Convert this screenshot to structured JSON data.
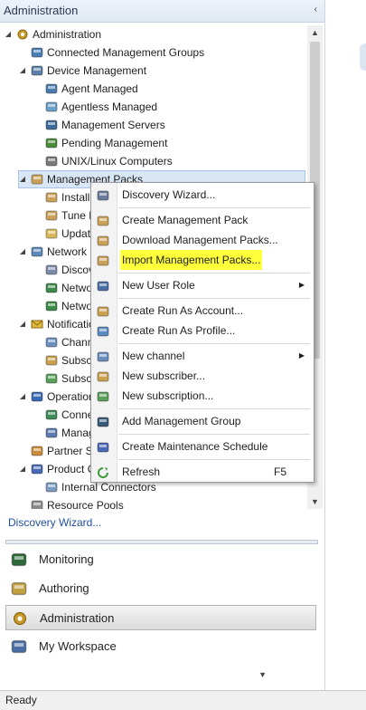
{
  "pane": {
    "title": "Administration",
    "collapse_glyph": "‹"
  },
  "tree": [
    {
      "label": "Administration",
      "icon": "gear-icon",
      "indent": 0,
      "expander": "◢"
    },
    {
      "label": "Connected Management Groups",
      "icon": "network-icon",
      "indent": 1,
      "expander": ""
    },
    {
      "label": "Device Management",
      "icon": "computer-icon",
      "indent": 1,
      "expander": "◢"
    },
    {
      "label": "Agent Managed",
      "icon": "agent-icon",
      "indent": 2,
      "expander": ""
    },
    {
      "label": "Agentless Managed",
      "icon": "agentless-icon",
      "indent": 2,
      "expander": ""
    },
    {
      "label": "Management Servers",
      "icon": "server-icon",
      "indent": 2,
      "expander": ""
    },
    {
      "label": "Pending Management",
      "icon": "pending-icon",
      "indent": 2,
      "expander": ""
    },
    {
      "label": "UNIX/Linux Computers",
      "icon": "unix-icon",
      "indent": 2,
      "expander": ""
    },
    {
      "label": "Management Packs",
      "icon": "package-icon",
      "indent": 1,
      "expander": "◢",
      "selected": true
    },
    {
      "label": "Installed",
      "icon": "package-icon",
      "indent": 2,
      "expander": ""
    },
    {
      "label": "Tune Mar",
      "icon": "package-icon",
      "indent": 2,
      "expander": ""
    },
    {
      "label": "Updates",
      "icon": "updates-icon",
      "indent": 2,
      "expander": ""
    },
    {
      "label": "Network M",
      "icon": "network-monitor-icon",
      "indent": 1,
      "expander": "◢"
    },
    {
      "label": "Discover",
      "icon": "discovery-icon",
      "indent": 2,
      "expander": ""
    },
    {
      "label": "Network",
      "icon": "network-device-icon",
      "indent": 2,
      "expander": ""
    },
    {
      "label": "Network",
      "icon": "network-device-icon",
      "indent": 2,
      "expander": ""
    },
    {
      "label": "Notificatio",
      "icon": "envelope-icon",
      "indent": 1,
      "expander": "◢"
    },
    {
      "label": "Channels",
      "icon": "channel-icon",
      "indent": 2,
      "expander": ""
    },
    {
      "label": "Subscrib",
      "icon": "subscriber-icon",
      "indent": 2,
      "expander": ""
    },
    {
      "label": "Subscrip",
      "icon": "subscription-icon",
      "indent": 2,
      "expander": ""
    },
    {
      "label": "Operation",
      "icon": "operations-icon",
      "indent": 1,
      "expander": "◢"
    },
    {
      "label": "Connecti",
      "icon": "globe-icon",
      "indent": 2,
      "expander": ""
    },
    {
      "label": "Managed",
      "icon": "managed-icon",
      "indent": 2,
      "expander": ""
    },
    {
      "label": "Partner So",
      "icon": "partner-icon",
      "indent": 1,
      "expander": ""
    },
    {
      "label": "Product Co",
      "icon": "product-icon",
      "indent": 1,
      "expander": "◢"
    },
    {
      "label": "Internal Connectors",
      "icon": "connector-icon",
      "indent": 2,
      "expander": ""
    },
    {
      "label": "Resource Pools",
      "icon": "pool-icon",
      "indent": 1,
      "expander": ""
    }
  ],
  "task_link": "Discovery Wizard...",
  "wunderbar": [
    {
      "label": "Monitoring",
      "icon": "monitoring-icon",
      "active": false
    },
    {
      "label": "Authoring",
      "icon": "authoring-icon",
      "active": false
    },
    {
      "label": "Administration",
      "icon": "gear-icon",
      "active": true
    },
    {
      "label": "My Workspace",
      "icon": "workspace-icon",
      "active": false
    }
  ],
  "more_glyph": "▼",
  "status": "Ready",
  "context_menu": [
    {
      "label": "Discovery Wizard...",
      "icon": "wizard-icon"
    },
    {
      "sep": true
    },
    {
      "label": "Create Management Pack",
      "icon": "package-icon"
    },
    {
      "label": "Download Management Packs...",
      "icon": "download-icon"
    },
    {
      "label": "Import Management Packs...",
      "icon": "import-icon",
      "highlight": true
    },
    {
      "sep": true
    },
    {
      "label": "New User Role",
      "icon": "user-role-icon",
      "submenu": true
    },
    {
      "sep": true
    },
    {
      "label": "Create Run As Account...",
      "icon": "runas-account-icon"
    },
    {
      "label": "Create Run As Profile...",
      "icon": "runas-profile-icon"
    },
    {
      "sep": true
    },
    {
      "label": "New channel",
      "icon": "channel-icon",
      "submenu": true
    },
    {
      "label": "New subscriber...",
      "icon": "subscriber-icon"
    },
    {
      "label": "New subscription...",
      "icon": "subscription-icon"
    },
    {
      "sep": true
    },
    {
      "label": "Add Management Group",
      "icon": "add-group-icon"
    },
    {
      "sep": true
    },
    {
      "label": "Create Maintenance Schedule",
      "icon": "maintenance-icon"
    },
    {
      "sep": true
    },
    {
      "label": "Refresh",
      "icon": "refresh-icon",
      "shortcut": "F5"
    }
  ],
  "colors": {
    "highlight": "#ffff3a",
    "link": "#1f4e9e",
    "selection": "#d8e6f6"
  }
}
